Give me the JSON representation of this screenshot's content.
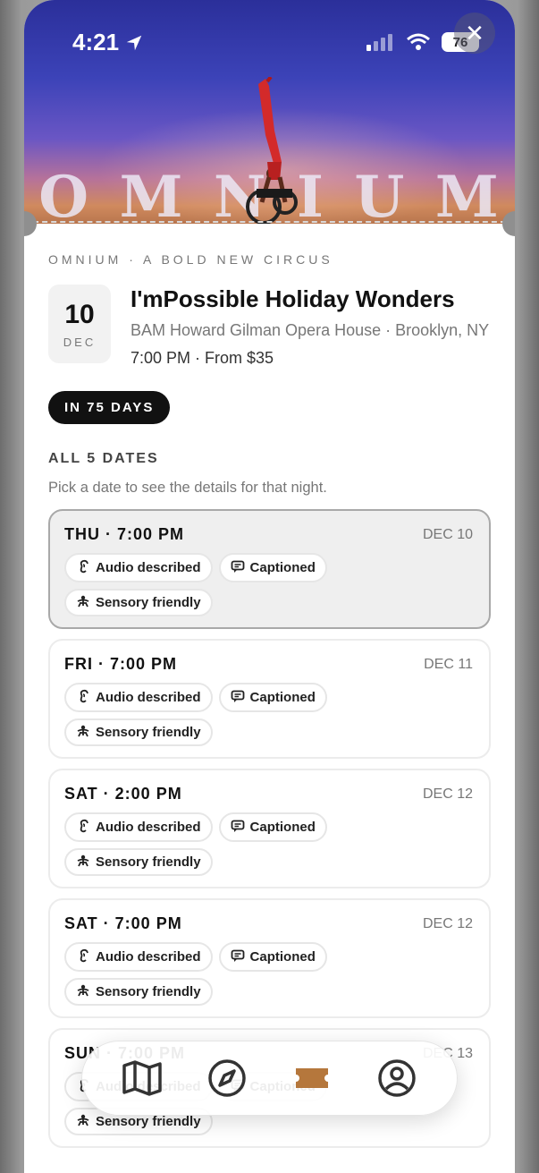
{
  "status_bar": {
    "time": "4:21",
    "battery": "76"
  },
  "hero": {
    "letters": [
      "O",
      "M",
      "N",
      "I",
      "U",
      "M"
    ]
  },
  "event": {
    "eyebrow": "OMNIUM · A BOLD NEW CIRCUS",
    "day": "10",
    "month": "DEC",
    "title": "I'mPossible Holiday Wonders",
    "venue": "BAM Howard Gilman Opera House · Brooklyn, NY",
    "time_price": "7:00 PM · From $35",
    "countdown": "IN 75 DAYS"
  },
  "dates_section": {
    "heading": "ALL 5 DATES",
    "subtext": "Pick a date to see the details for that night.",
    "tag_labels": {
      "audio": "Audio described",
      "caption": "Captioned",
      "sensory": "Sensory friendly"
    },
    "items": [
      {
        "time": "THU · 7:00 PM",
        "date": "DEC 10",
        "selected": true
      },
      {
        "time": "FRI · 7:00 PM",
        "date": "DEC 11",
        "selected": false
      },
      {
        "time": "SAT · 2:00 PM",
        "date": "DEC 12",
        "selected": false
      },
      {
        "time": "SAT · 7:00 PM",
        "date": "DEC 12",
        "selected": false
      },
      {
        "time": "SUN · 7:00 PM",
        "date": "DEC 13",
        "selected": false
      }
    ]
  },
  "tab_bar": {
    "tabs": [
      {
        "icon": "map-icon",
        "active": false
      },
      {
        "icon": "compass-icon",
        "active": false
      },
      {
        "icon": "ticket-icon",
        "active": true,
        "color": "#b5773c"
      },
      {
        "icon": "profile-icon",
        "active": false
      }
    ]
  },
  "colors": {
    "accent": "#b5773c",
    "selected_card": "#efefef"
  }
}
